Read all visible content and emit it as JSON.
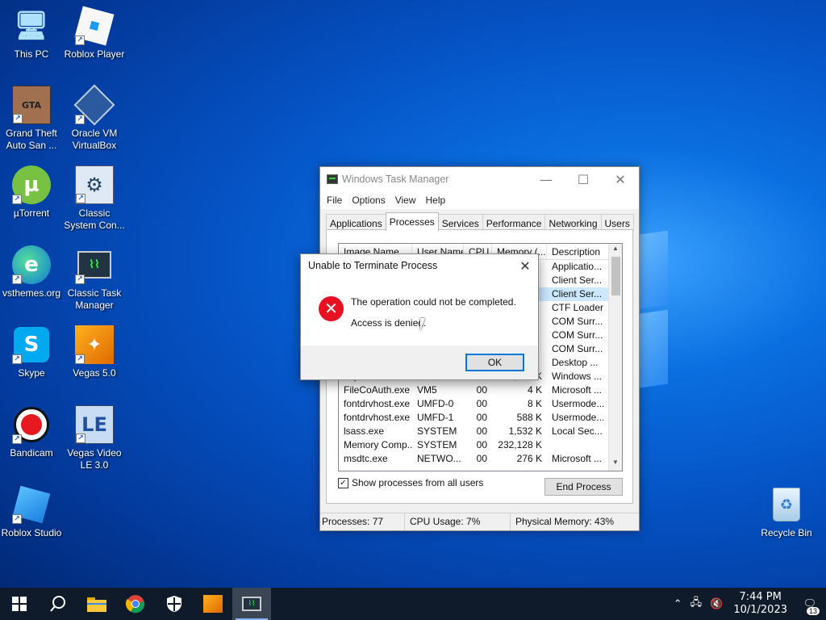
{
  "desktop": {
    "icons": [
      {
        "label": "This PC",
        "glyph": "🖥"
      },
      {
        "label": "Roblox Player",
        "glyph": "▣"
      },
      {
        "label": "Grand Theft Auto San ...",
        "glyph": "GTA"
      },
      {
        "label": "Oracle VM VirtualBox",
        "glyph": "▢"
      },
      {
        "label": "µTorrent",
        "glyph": "µ"
      },
      {
        "label": "Classic System Con...",
        "glyph": "⚙"
      },
      {
        "label": "vsthemes.org",
        "glyph": "e"
      },
      {
        "label": "Classic Task Manager",
        "glyph": "▤"
      },
      {
        "label": "Skype",
        "glyph": "S"
      },
      {
        "label": "Vegas 5.0",
        "glyph": "✦"
      },
      {
        "label": "Bandicam",
        "glyph": "●"
      },
      {
        "label": "Vegas Video LE 3.0",
        "glyph": "LE"
      },
      {
        "label": "Roblox Studio",
        "glyph": "◧"
      },
      {
        "label": "Recycle Bin",
        "glyph": "♻"
      }
    ]
  },
  "task_manager": {
    "title": "Windows Task Manager",
    "menu": [
      "File",
      "Options",
      "View",
      "Help"
    ],
    "tabs": [
      "Applications",
      "Processes",
      "Services",
      "Performance",
      "Networking",
      "Users"
    ],
    "active_tab": "Processes",
    "columns": [
      "Image Name",
      "User Name",
      "CPU",
      "Memory (...",
      "Description"
    ],
    "rows": [
      {
        "image": "",
        "user": "",
        "cpu": "",
        "mem": "",
        "desc": "Applicatio..."
      },
      {
        "image": "",
        "user": "",
        "cpu": "",
        "mem": "",
        "desc": "Client Ser..."
      },
      {
        "image": "",
        "user": "",
        "cpu": "",
        "mem": "",
        "desc": "Client Ser...",
        "selected": true
      },
      {
        "image": "",
        "user": "",
        "cpu": "",
        "mem": "",
        "desc": "CTF Loader"
      },
      {
        "image": "",
        "user": "",
        "cpu": "",
        "mem": "",
        "desc": "COM Surr..."
      },
      {
        "image": "",
        "user": "",
        "cpu": "",
        "mem": "",
        "desc": "COM Surr..."
      },
      {
        "image": "",
        "user": "",
        "cpu": "",
        "mem": "",
        "desc": "COM Surr..."
      },
      {
        "image": "",
        "user": "",
        "cpu": "",
        "mem": "",
        "desc": "Desktop ..."
      },
      {
        "image": "explorer.exe",
        "user": "VM5",
        "cpu": "00",
        "mem": "15,284 K",
        "desc": "Windows ..."
      },
      {
        "image": "FileCoAuth.exe",
        "user": "VM5",
        "cpu": "00",
        "mem": "4 K",
        "desc": "Microsoft ..."
      },
      {
        "image": "fontdrvhost.exe",
        "user": "UMFD-0",
        "cpu": "00",
        "mem": "8 K",
        "desc": "Usermode..."
      },
      {
        "image": "fontdrvhost.exe",
        "user": "UMFD-1",
        "cpu": "00",
        "mem": "588 K",
        "desc": "Usermode..."
      },
      {
        "image": "lsass.exe",
        "user": "SYSTEM",
        "cpu": "00",
        "mem": "1,532 K",
        "desc": "Local Sec..."
      },
      {
        "image": "Memory Comp...",
        "user": "SYSTEM",
        "cpu": "00",
        "mem": "232,128 K",
        "desc": ""
      },
      {
        "image": "msdtc.exe",
        "user": "NETWO...",
        "cpu": "00",
        "mem": "276 K",
        "desc": "Microsoft ..."
      }
    ],
    "show_all_label": "Show processes from all users",
    "show_all_checked": "✓",
    "end_process_label": "End Process",
    "status": {
      "processes": "Processes: 77",
      "cpu": "CPU Usage: 7%",
      "memory": "Physical Memory: 43%"
    }
  },
  "dialog": {
    "title": "Unable to Terminate Process",
    "message": "The operation could not be completed.",
    "detail": "Access is denied.",
    "ok_label": "OK",
    "error_glyph": "✕"
  },
  "taskbar": {
    "clock_time": "7:44 PM",
    "clock_date": "10/1/2023",
    "notification_count": "13"
  }
}
